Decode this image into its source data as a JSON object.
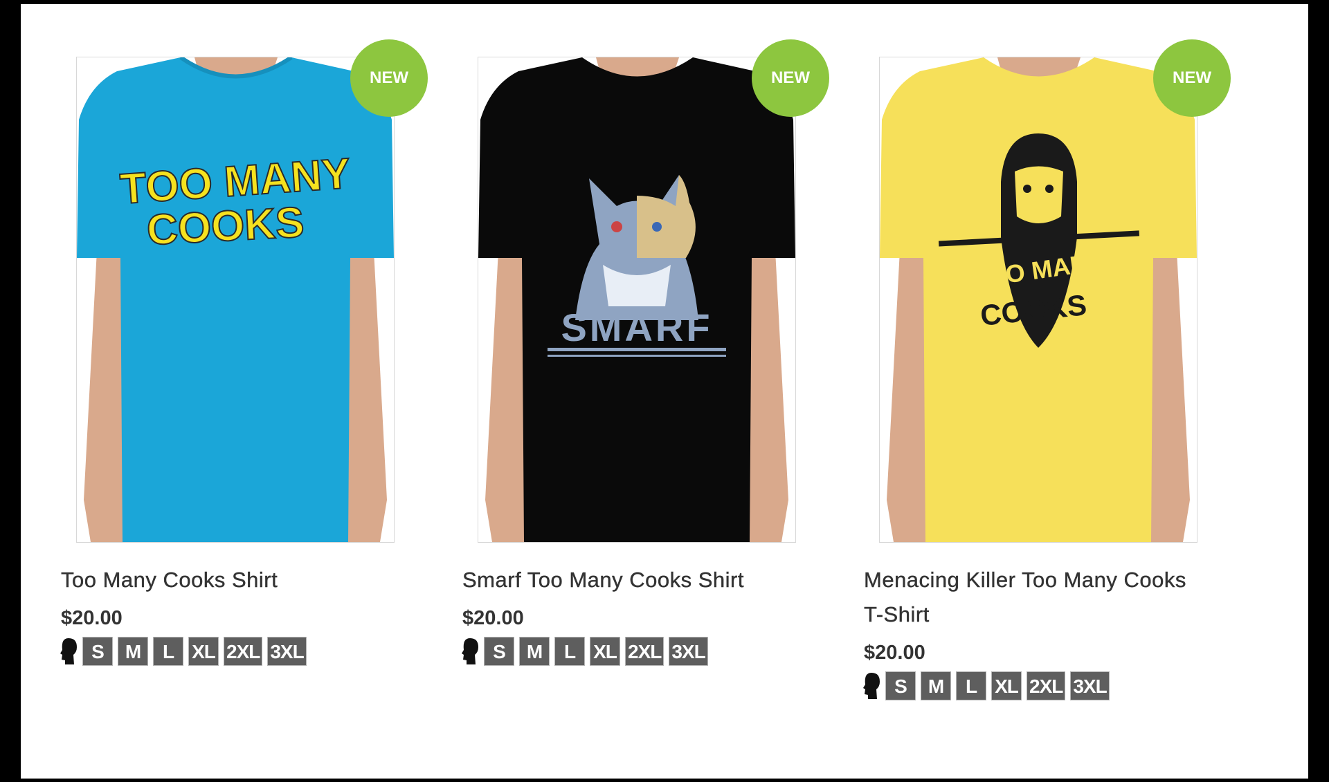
{
  "colors": {
    "badge": "#8dc63f",
    "size_chip": "#5e5e5e",
    "shirt_blue": "#1ba6d8",
    "shirt_black": "#0a0a0a",
    "shirt_yellow": "#f6e05a"
  },
  "products": [
    {
      "badge": "NEW",
      "title": "Too Many Cooks Shirt",
      "price": "$20.00",
      "size_icon": "head-silhouette-icon",
      "sizes": [
        "S",
        "M",
        "L",
        "XL",
        "2XL",
        "3XL"
      ],
      "graphic_text": [
        "TOO MANY",
        "COOKS"
      ]
    },
    {
      "badge": "NEW",
      "title": "Smarf Too Many Cooks Shirt",
      "price": "$20.00",
      "size_icon": "head-silhouette-icon",
      "sizes": [
        "S",
        "M",
        "L",
        "XL",
        "2XL",
        "3XL"
      ],
      "graphic_text": [
        "SMARF"
      ]
    },
    {
      "badge": "NEW",
      "title": "Menacing Killer Too Many Cooks T-Shirt",
      "price": "$20.00",
      "size_icon": "head-silhouette-icon",
      "sizes": [
        "S",
        "M",
        "L",
        "XL",
        "2XL",
        "3XL"
      ],
      "graphic_text": [
        "TOO MANY",
        "COOKS"
      ]
    }
  ]
}
